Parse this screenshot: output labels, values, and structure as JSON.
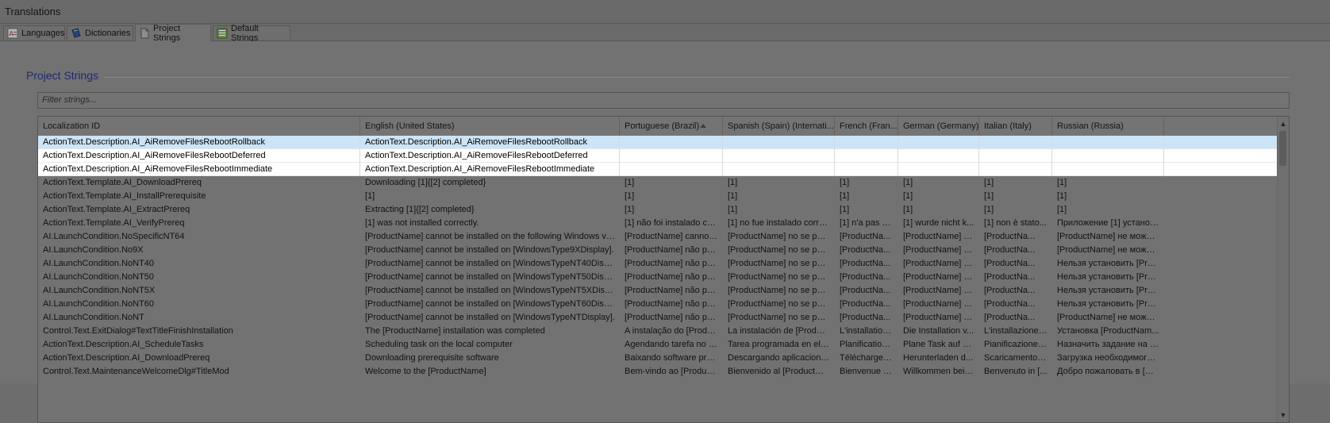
{
  "window": {
    "title": "Translations"
  },
  "tabs": [
    {
      "label": "Languages",
      "icon": "languages-icon"
    },
    {
      "label": "Dictionaries",
      "icon": "dictionaries-icon"
    },
    {
      "label": "Project Strings",
      "icon": "project-strings-icon",
      "active": true
    },
    {
      "label": "Default Strings",
      "icon": "default-strings-icon"
    }
  ],
  "section": {
    "title": "Project Strings"
  },
  "filter": {
    "placeholder": "Filter strings..."
  },
  "grid": {
    "columns": [
      "Localization ID",
      "English (United States)",
      "Portuguese (Brazil)",
      "Spanish (Spain) (Internati...",
      "French (Fran...",
      "German (Germany)",
      "Italian (Italy)",
      "Russian (Russia)"
    ],
    "sort_column": "Portuguese (Brazil)",
    "rows": [
      [
        "ActionText.Description.AI_AiRemoveFilesRebootRollback",
        "ActionText.Description.AI_AiRemoveFilesRebootRollback",
        "",
        "",
        "",
        "",
        "",
        ""
      ],
      [
        "ActionText.Description.AI_AiRemoveFilesRebootDeferred",
        "ActionText.Description.AI_AiRemoveFilesRebootDeferred",
        "",
        "",
        "",
        "",
        "",
        ""
      ],
      [
        "ActionText.Description.AI_AiRemoveFilesRebootImmediate",
        "ActionText.Description.AI_AiRemoveFilesRebootImmediate",
        "",
        "",
        "",
        "",
        "",
        ""
      ],
      [
        "ActionText.Template.AI_DownloadPrereq",
        "Downloading [1]{[2] completed}",
        "[1]",
        "[1]",
        "[1]",
        "[1]",
        "[1]",
        "[1]"
      ],
      [
        "ActionText.Template.AI_InstallPrerequisite",
        "[1]",
        "[1]",
        "[1]",
        "[1]",
        "[1]",
        "[1]",
        "[1]"
      ],
      [
        "ActionText.Template.AI_ExtractPrereq",
        "Extracting [1]{[2] completed}",
        "[1]",
        "[1]",
        "[1]",
        "[1]",
        "[1]",
        "[1]"
      ],
      [
        "ActionText.Template.AI_VerifyPrereq",
        "[1] was not installed correctly.",
        "[1] não foi instalado cor...",
        "[1] no fue instalado corre...",
        "[1] n'a pas é...",
        "[1] wurde nicht k...",
        "[1] non è stato...",
        "Приложение [1] установ..."
      ],
      [
        "AI.LaunchCondition.NoSpecificNT64",
        "[ProductName] cannot be installed on the following Windows versio...",
        "[ProductName] cannot ...",
        "[ProductName] no se pue...",
        "[ProductNa...",
        "[ProductName] k...",
        "[ProductNa...",
        "[ProductName] не может..."
      ],
      [
        "AI.LaunchCondition.No9X",
        "[ProductName] cannot be installed on [WindowsType9XDisplay].",
        "[ProductName] não pod...",
        "[ProductName] no se pue...",
        "[ProductNa...",
        "[ProductName] k...",
        "[ProductNa...",
        "[ProductName] не может..."
      ],
      [
        "AI.LaunchCondition.NoNT40",
        "[ProductName] cannot be installed on [WindowsTypeNT40Display].",
        "[ProductName] não pod...",
        "[ProductName] no se pue...",
        "[ProductNa...",
        "[ProductName] k...",
        "[ProductNa...",
        "Нельзя установить [Pro..."
      ],
      [
        "AI.LaunchCondition.NoNT50",
        "[ProductName] cannot be installed on [WindowsTypeNT50Display].",
        "[ProductName] não pod...",
        "[ProductName] no se pue...",
        "[ProductNa...",
        "[ProductName] k...",
        "[ProductNa...",
        "Нельзя установить [Pro..."
      ],
      [
        "AI.LaunchCondition.NoNT5X",
        "[ProductName] cannot be installed on [WindowsTypeNT5XDisplay].",
        "[ProductName] não pod...",
        "[ProductName] no se pue...",
        "[ProductNa...",
        "[ProductName] k...",
        "[ProductNa...",
        "Нельзя установить [Pro..."
      ],
      [
        "AI.LaunchCondition.NoNT60",
        "[ProductName] cannot be installed on [WindowsTypeNT60Display].",
        "[ProductName] não pod...",
        "[ProductName] no se pue...",
        "[ProductNa...",
        "[ProductName] k...",
        "[ProductNa...",
        "Нельзя установить [Pro..."
      ],
      [
        "AI.LaunchCondition.NoNT",
        "[ProductName] cannot be installed on [WindowsTypeNTDisplay].",
        "[ProductName] não pod...",
        "[ProductName] no se pue...",
        "[ProductNa...",
        "[ProductName] k...",
        "[ProductNa...",
        "[ProductName] не может..."
      ],
      [
        "Control.Text.ExitDialog#TextTitleFinishInstallation",
        "The [ProductName] installation was completed",
        "A instalação do [Product...",
        "La instalación de [Product...",
        "L'installation...",
        "Die Installation v...",
        "L'installazione ...",
        "Установка [ProductNam..."
      ],
      [
        "ActionText.Description.AI_ScheduleTasks",
        "Scheduling task on the local computer",
        "Agendando tarefa no c...",
        "Tarea programada en el o...",
        "Planification ...",
        "Plane Task auf d...",
        "Pianificazione o...",
        "Назначить задание на л..."
      ],
      [
        "ActionText.Description.AI_DownloadPrereq",
        "Downloading prerequisite software",
        "Baixando software pré-...",
        "Descargando aplicaciones...",
        "Téléchargeme...",
        "Herunterladen d...",
        "Scaricamento p...",
        "Загрузка необходимого ..."
      ],
      [
        "Control.Text.MaintenanceWelcomeDlg#TitleMod",
        "Welcome to the [ProductName]",
        "Bem-vindo ao [Product...",
        "Bienvenido al [ProductNa...",
        "Bienvenue d...",
        "Willkommen bei [...",
        "Benvenuto in [...",
        "Добро пожаловать в [Pr..."
      ]
    ],
    "selected_row": 0,
    "highlighted_rows": [
      0,
      1,
      2
    ]
  },
  "scrollbar": {
    "up_glyph": "▲",
    "down_glyph": "▼"
  }
}
